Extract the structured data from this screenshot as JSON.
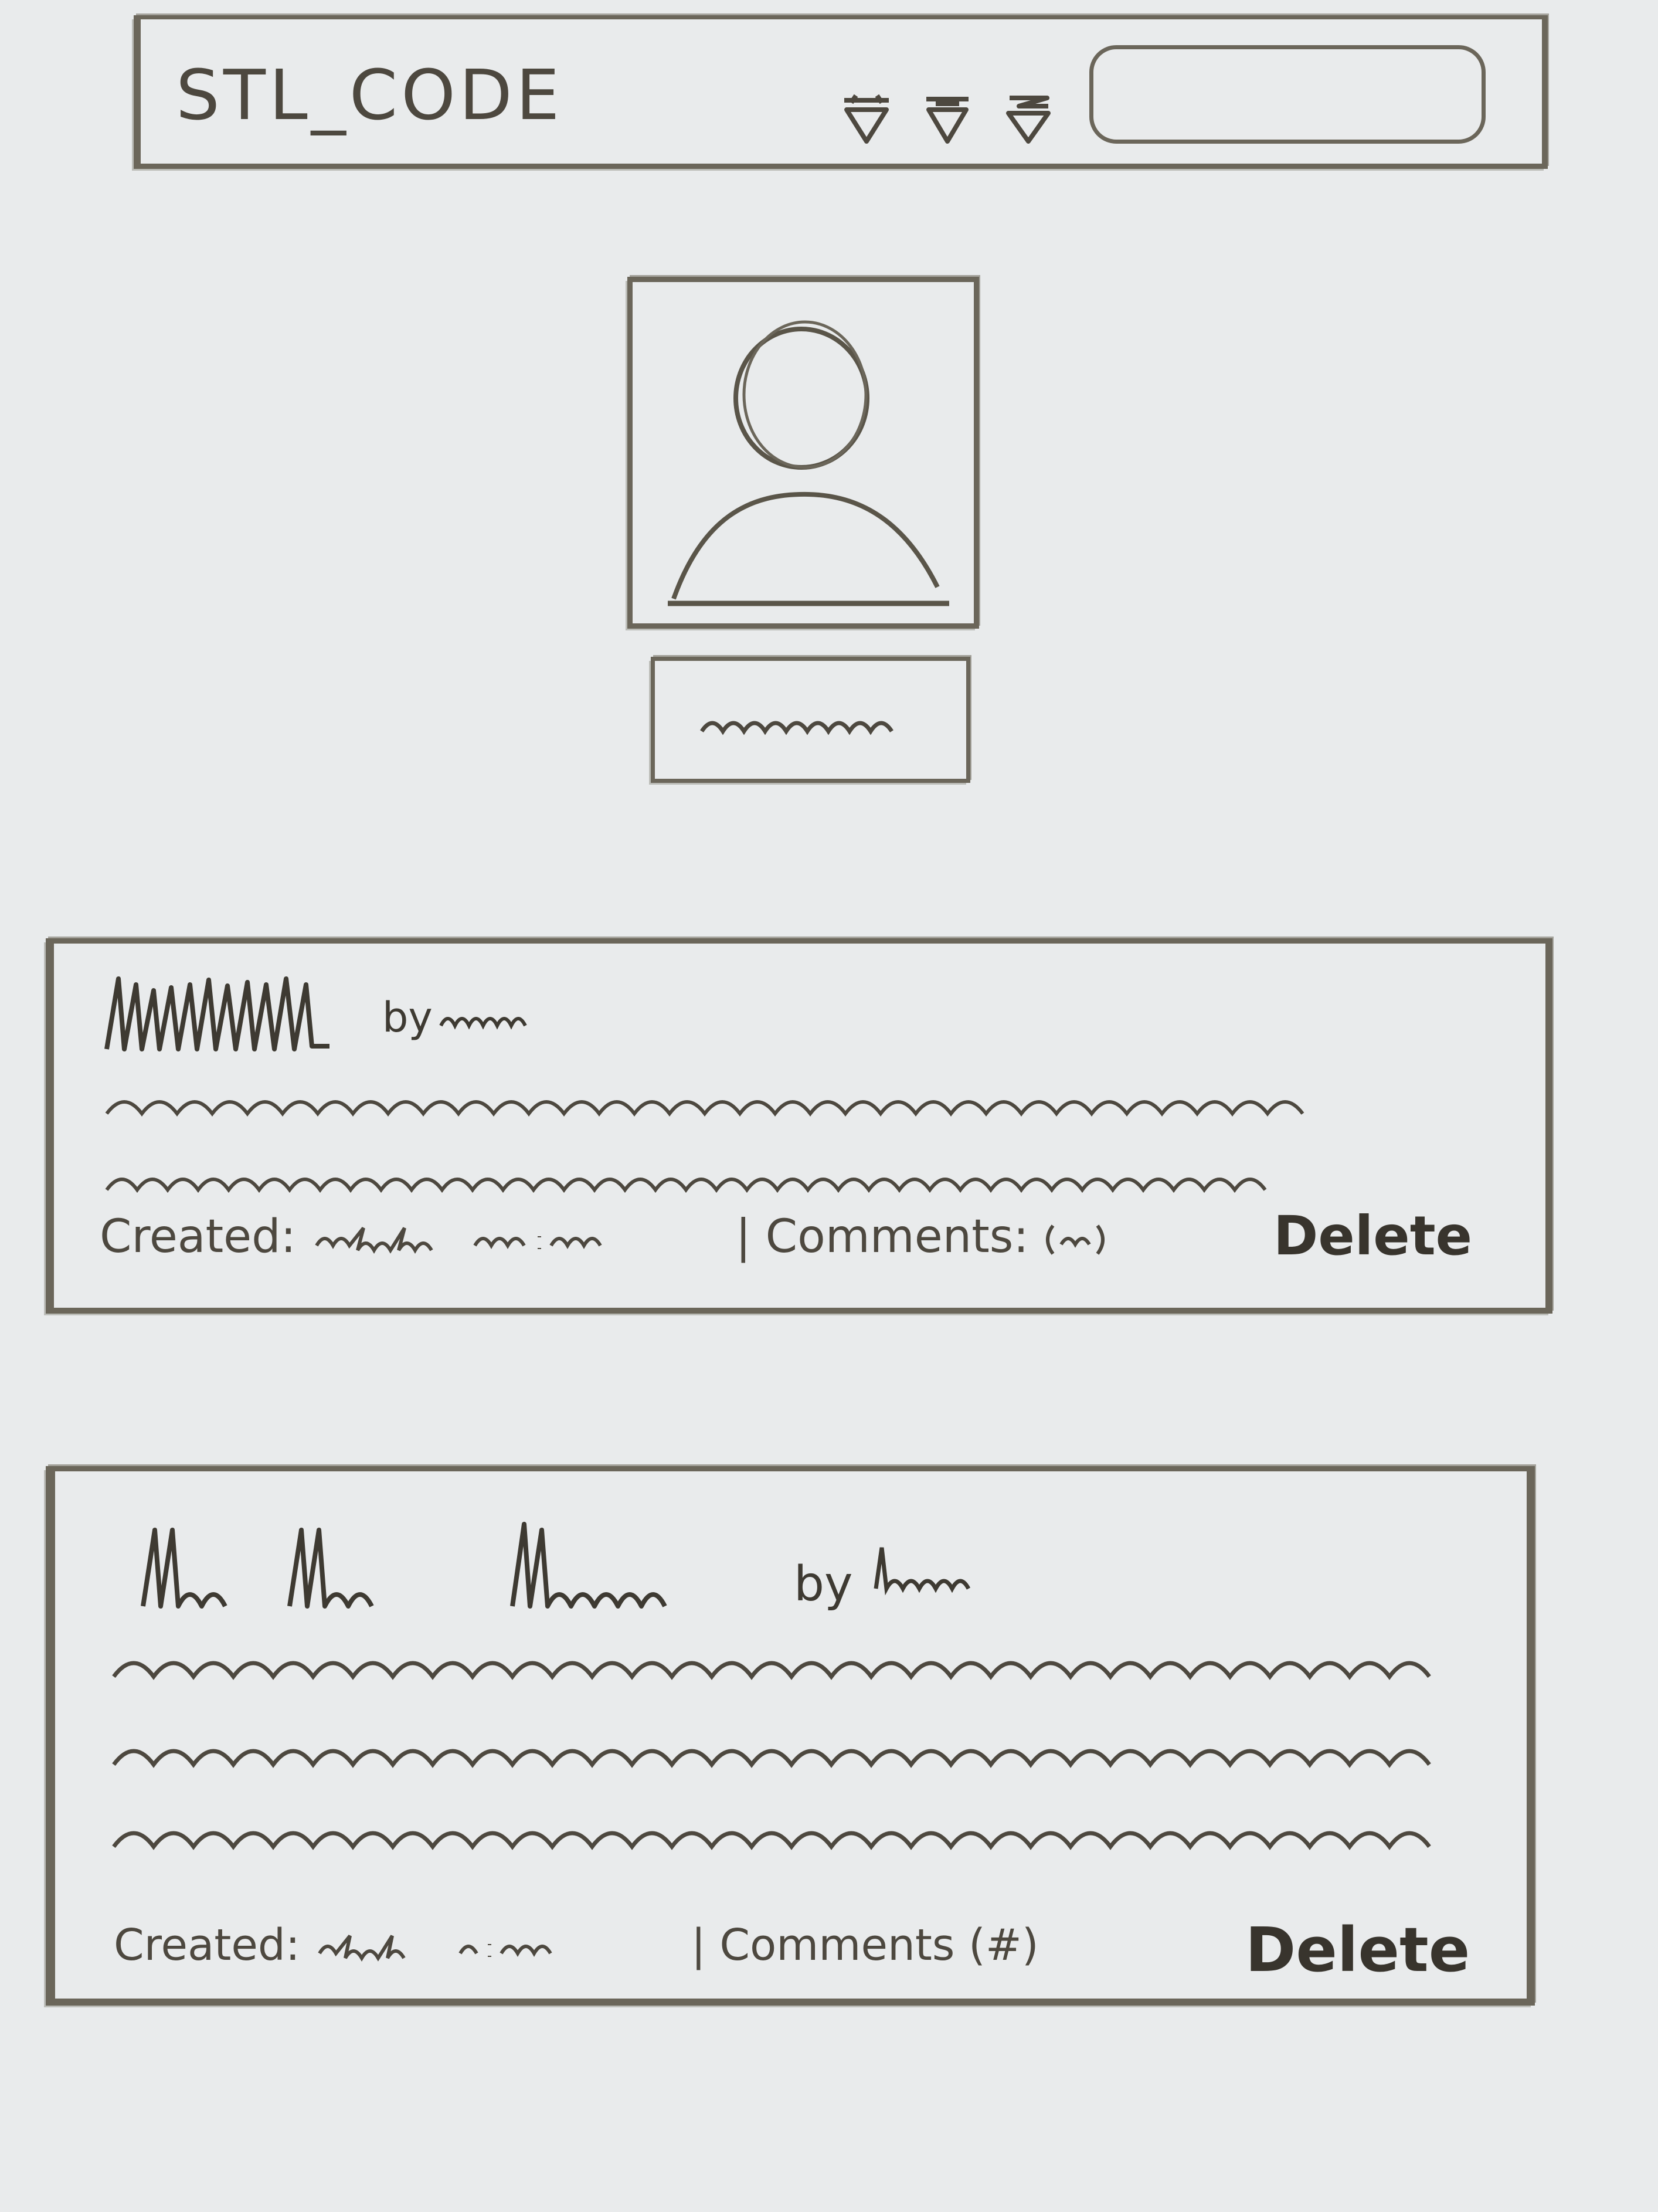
{
  "header": {
    "brand": "STL_CODE",
    "nav_icons": [
      "nav-icon-1",
      "nav-icon-2",
      "nav-icon-3"
    ],
    "search": {
      "value": ""
    }
  },
  "profile": {
    "avatar_icon": "user-avatar-icon",
    "username_placeholder": "scribbled name"
  },
  "posts": [
    {
      "by_label": "by",
      "created_label": "Created:",
      "separator": "|",
      "comments_label": "Comments:",
      "delete_label": "Delete"
    },
    {
      "by_label": "by",
      "created_label": "Created:",
      "separator": "|",
      "comments_label": "Comments",
      "comments_count": "(#)",
      "delete_label": "Delete"
    }
  ]
}
